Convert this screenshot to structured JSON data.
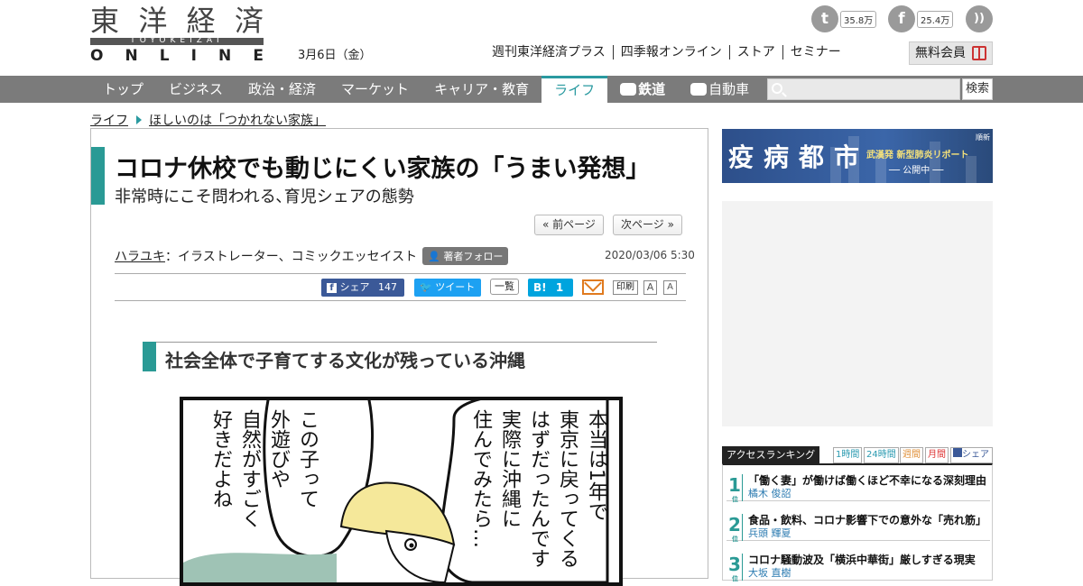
{
  "header": {
    "logo": {
      "kanji": [
        "東",
        "洋",
        "経",
        "済"
      ],
      "band": "TOYOKEIZAI",
      "online": [
        "O",
        "N",
        "L",
        "I",
        "N",
        "E"
      ]
    },
    "date": "3月6日（金）",
    "top_links": [
      "週刊東洋経済プラス",
      "四季報オンライン",
      "ストア",
      "セミナー"
    ],
    "member_button": "無料会員",
    "social": {
      "twitter_count": "35.8万",
      "facebook_count": "25.4万"
    }
  },
  "nav": {
    "items": [
      "トップ",
      "ビジネス",
      "政治・経済",
      "マーケット",
      "キャリア・教育",
      "ライフ",
      "鉄道",
      "自動車"
    ],
    "active": "ライフ",
    "search_button": "検索"
  },
  "breadcrumb": {
    "section": "ライフ",
    "series": "ほしいのは「つかれない家族」"
  },
  "article": {
    "title": "コロナ休校でも動じにくい家族の「うまい発想」",
    "subtitle": "非常時にこそ問われる､育児シェアの態勢",
    "prev_page": "« 前ページ",
    "next_page": "次ページ »",
    "author": "ハラユキ",
    "author_role": "：イラストレーター、コミックエッセイスト",
    "follow_button": "著者フォロー",
    "published": "2020/03/06 5:30",
    "share": {
      "facebook_label": "シェア",
      "facebook_count": "147",
      "tweet_label": "ツイート",
      "list_label": "一覧",
      "hatena_label": "B!",
      "hatena_count": "1",
      "print_label": "印刷",
      "font_small": "A",
      "font_large": "A"
    },
    "section_title": "社会全体で子育てする文化が残っている沖縄",
    "manga": {
      "bubble_right": [
        "本当は1年で",
        "東京に戻ってくる",
        "はずだったんです",
        "実際に沖縄に",
        "住んでみたら…"
      ],
      "bubble_left": [
        "この子って",
        "外遊びや",
        "自然がすごく",
        "好きだよね"
      ]
    }
  },
  "sidebar": {
    "banner": {
      "title": "疫病都市",
      "subtitle": "武漢発 新型肺炎リポート",
      "status": "── 公開中 ──",
      "tag": "順新"
    },
    "ranking": {
      "label": "アクセスランキング",
      "tabs": [
        "1時間",
        "24時間",
        "週間",
        "月間",
        "シェア"
      ],
      "items": [
        {
          "rank": "1",
          "unit": "位",
          "title": "「働く妻」が働けば働くほど不幸になる深刻理由",
          "author": "橘木 俊詔"
        },
        {
          "rank": "2",
          "unit": "位",
          "title": "食品・飲料、コロナ影響下での意外な「売れ筋」",
          "author": "兵頭 輝夏"
        },
        {
          "rank": "3",
          "unit": "位",
          "title": "コロナ騒動波及「横浜中華街」厳しすぎる現実",
          "author": "大坂 直樹"
        }
      ]
    }
  },
  "colors": {
    "accent_teal": "#2a9a95",
    "nav_gray": "#7b7b7b",
    "facebook": "#3b5998",
    "twitter": "#1da1f2",
    "hatena": "#00a4de"
  }
}
